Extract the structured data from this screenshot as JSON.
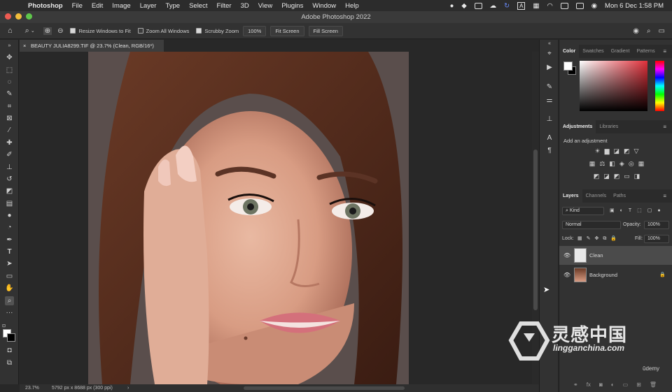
{
  "menubar": {
    "app": "Photoshop",
    "items": [
      "File",
      "Edit",
      "Image",
      "Layer",
      "Type",
      "Select",
      "Filter",
      "3D",
      "View",
      "Plugins",
      "Window",
      "Help"
    ],
    "clock": "Mon 6 Dec  1:58 PM",
    "status_a": "A"
  },
  "window_title": "Adobe Photoshop 2022",
  "options_bar": {
    "resize_windows": "Resize Windows to Fit",
    "zoom_all": "Zoom All Windows",
    "scrubby_zoom": "Scrubby Zoom",
    "zoom_value": "100%",
    "fit_screen": "Fit Screen",
    "fill_screen": "Fill Screen"
  },
  "document_tab": {
    "close": "×",
    "title": "BEAUTY JULIA8299.TIF @ 23.7% (Clean, RGB/16*)"
  },
  "status_bar": {
    "zoom": "23.7%",
    "info": "5792 px x 8688 px (300 ppi)",
    "arrow": "›"
  },
  "color_panel": {
    "tabs": [
      "Color",
      "Swatches",
      "Gradient",
      "Patterns"
    ],
    "foreground": "#ffffff",
    "background": "#000000"
  },
  "adjustments_panel": {
    "tabs": [
      "Adjustments",
      "Libraries"
    ],
    "label": "Add an adjustment"
  },
  "layers_panel": {
    "tabs": [
      "Layers",
      "Channels",
      "Paths"
    ],
    "filter": "Kind",
    "blend_mode": "Normal",
    "opacity_label": "Opacity:",
    "opacity_value": "100%",
    "lock_label": "Lock:",
    "fill_label": "Fill:",
    "fill_value": "100%",
    "layers": [
      {
        "name": "Clean",
        "selected": true
      },
      {
        "name": "Background",
        "selected": false
      }
    ],
    "bottom_fx": "fx"
  },
  "watermark": {
    "title": "灵感中国",
    "url": "lingganchina.com",
    "brand": "ûdemy"
  },
  "colors": {
    "accent": "#e0303a",
    "panel_bg": "#323232",
    "canvas_bg": "#282828"
  }
}
